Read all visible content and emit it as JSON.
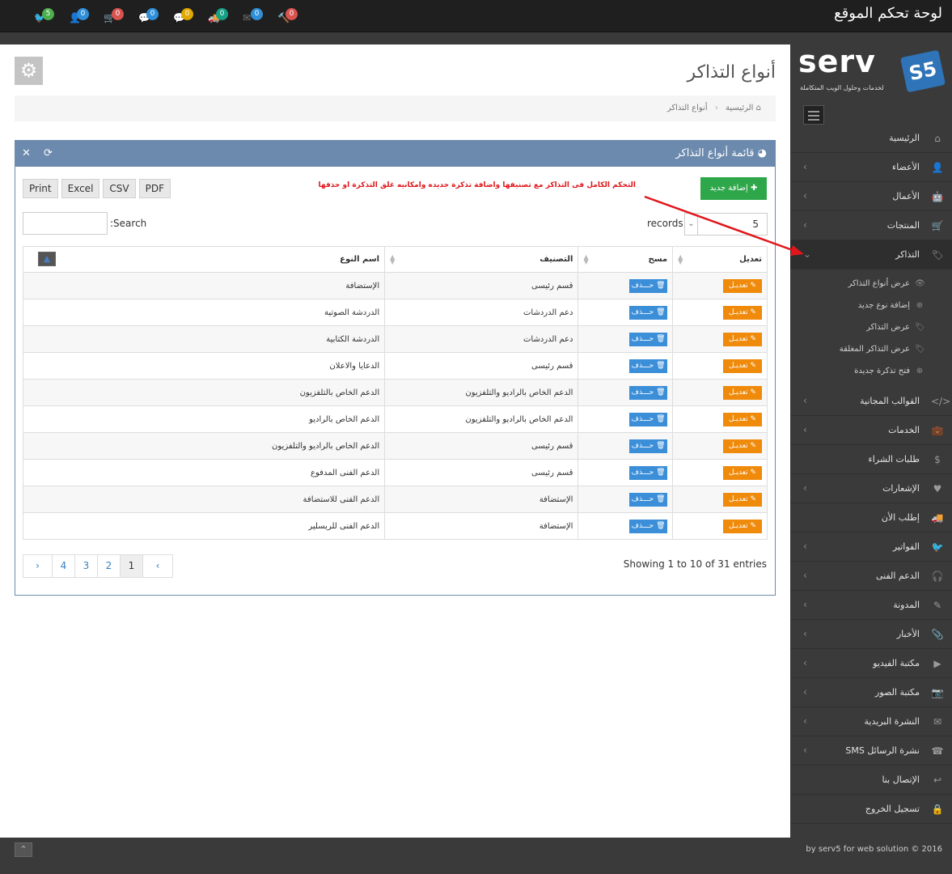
{
  "app": {
    "title": "لوحة تحكم الموقع"
  },
  "notifications": [
    {
      "icon": "twitter-icon",
      "glyph": "🐦",
      "count": "5",
      "color": "#4cae4c"
    },
    {
      "icon": "user-plus-icon",
      "glyph": "👤",
      "count": "0",
      "color": "#2f8fd8"
    },
    {
      "icon": "cart-icon",
      "glyph": "🛒",
      "count": "0",
      "color": "#d9534f"
    },
    {
      "icon": "comment-icon",
      "glyph": "💬",
      "count": "0",
      "color": "#2f8fd8"
    },
    {
      "icon": "chat-icon",
      "glyph": "💬",
      "count": "0",
      "color": "#e0a800"
    },
    {
      "icon": "truck-icon",
      "glyph": "🚚",
      "count": "0",
      "color": "#16a085"
    },
    {
      "icon": "envelope-icon",
      "glyph": "✉",
      "count": "0",
      "color": "#2f8fd8"
    },
    {
      "icon": "gavel-icon",
      "glyph": "🔨",
      "count": "0",
      "color": "#d9534f"
    }
  ],
  "logo": {
    "word": "serv",
    "mark": "S5",
    "tagline": "لخدمات وحلول الويب المتكاملة"
  },
  "sidebar": {
    "items": [
      {
        "label": "الرئيسية",
        "icon": "home-icon",
        "glyph": "⌂",
        "chevron": false
      },
      {
        "label": "الأعضاء",
        "icon": "user-icon",
        "glyph": "👤",
        "chevron": true
      },
      {
        "label": "الأعمال",
        "icon": "android-icon",
        "glyph": "🤖",
        "chevron": true
      },
      {
        "label": "المنتجات",
        "icon": "cart-icon",
        "glyph": "🛒",
        "chevron": true
      },
      {
        "label": "التذاكر",
        "icon": "tags-icon",
        "glyph": "🏷",
        "chevron": true,
        "active": true
      },
      {
        "label": "القوالب المجانية",
        "icon": "code-icon",
        "glyph": "</>",
        "chevron": true
      },
      {
        "label": "الخدمات",
        "icon": "briefcase-icon",
        "glyph": "💼",
        "chevron": true
      },
      {
        "label": "طلبات الشراء",
        "icon": "dollar-icon",
        "glyph": "$",
        "chevron": false
      },
      {
        "label": "الإشعارات",
        "icon": "heart-icon",
        "glyph": "♥",
        "chevron": true
      },
      {
        "label": "إطلب الأن",
        "icon": "truck-icon",
        "glyph": "🚚",
        "chevron": false
      },
      {
        "label": "الفواتير",
        "icon": "twitter-icon",
        "glyph": "🐦",
        "chevron": true
      },
      {
        "label": "الدعم الفنى",
        "icon": "headphones-icon",
        "glyph": "🎧",
        "chevron": true
      },
      {
        "label": "المدونة",
        "icon": "edit-icon",
        "glyph": "✎",
        "chevron": true
      },
      {
        "label": "الأخبار",
        "icon": "paperclip-icon",
        "glyph": "📎",
        "chevron": true
      },
      {
        "label": "مكتبة الفيديو",
        "icon": "video-icon",
        "glyph": "▶",
        "chevron": true
      },
      {
        "label": "مكتبة الصور",
        "icon": "camera-icon",
        "glyph": "📷",
        "chevron": true
      },
      {
        "label": "النشرة البريدية",
        "icon": "envelope-icon",
        "glyph": "✉",
        "chevron": true
      },
      {
        "label": "نشرة الرسائل SMS",
        "icon": "phone-icon",
        "glyph": "☎",
        "chevron": true
      },
      {
        "label": "الإتصال بنا",
        "icon": "reply-icon",
        "glyph": "↩",
        "chevron": false
      },
      {
        "label": "تسجيل الخروج",
        "icon": "lock-icon",
        "glyph": "🔒",
        "chevron": false
      }
    ],
    "submenu": [
      {
        "label": "عرض أنواع التذاكر",
        "icon": "eye-icon",
        "glyph": "👁"
      },
      {
        "label": "إضافة نوع جديد",
        "icon": "plus-circle-icon",
        "glyph": "⊕"
      },
      {
        "label": "عرض التذاكر",
        "icon": "tags-icon",
        "glyph": "🏷"
      },
      {
        "label": "عرض التذاكر المغلقة",
        "icon": "tags-icon",
        "glyph": "🏷"
      },
      {
        "label": "فتح تذكرة جديدة",
        "icon": "plus-circle-icon",
        "glyph": "⊕"
      }
    ]
  },
  "page": {
    "title": "أنواع التذاكر"
  },
  "breadcrumb": {
    "home": "الرئيسية",
    "sep": "‹",
    "current": "أنواع التذاكر"
  },
  "panel": {
    "title": "قائمة أنواع التذاكر",
    "tools": "✕ ⟳"
  },
  "add_button": "إضافة جديد",
  "note": "التحكم الكامل فى التذاكر مع تصنيفها واضافة تذكرة جديده وامكانيه غلق التذكرة او حذفها",
  "export_buttons": [
    "Print",
    "Excel",
    "CSV",
    "PDF"
  ],
  "search": {
    "label": ":Search",
    "value": ""
  },
  "records": {
    "value": "5",
    "label": "records"
  },
  "table": {
    "headers": {
      "name": "اسم النوع",
      "category": "التصنيف",
      "delete": "مسح",
      "edit": "تعديل"
    },
    "delete_label": "حـــذف",
    "edit_label": "تعديـل",
    "rows": [
      {
        "name": "الإستضافة",
        "category": "قسم رئيسى"
      },
      {
        "name": "الدردشة الصوتية",
        "category": "دعم الدردشات"
      },
      {
        "name": "الدردشة الكتابية",
        "category": "دعم الدردشات"
      },
      {
        "name": "الدعايا والاعلان",
        "category": "قسم رئيسى"
      },
      {
        "name": "الدعم الخاص بالتلفزيون",
        "category": "الدعم الخاص بالراديو والتلفزيون"
      },
      {
        "name": "الدعم الخاص بالراديو",
        "category": "الدعم الخاص بالراديو والتلفزيون"
      },
      {
        "name": "الدعم الخاص بالراديو والتلفزيون",
        "category": "قسم رئيسى"
      },
      {
        "name": "الدعم الفنى المدفوع",
        "category": "قسم رئيسى"
      },
      {
        "name": "الدعم الفنى للاستضافة",
        "category": "الإستضافة"
      },
      {
        "name": "الدعم الفنى للريسلير",
        "category": "الإستضافة"
      }
    ]
  },
  "info": "Showing 1 to 10 of 31 entries",
  "pagination": [
    "›",
    "4",
    "3",
    "2",
    "1",
    "‹"
  ],
  "footer": {
    "text": "by serv5 for web solution © 2016"
  }
}
